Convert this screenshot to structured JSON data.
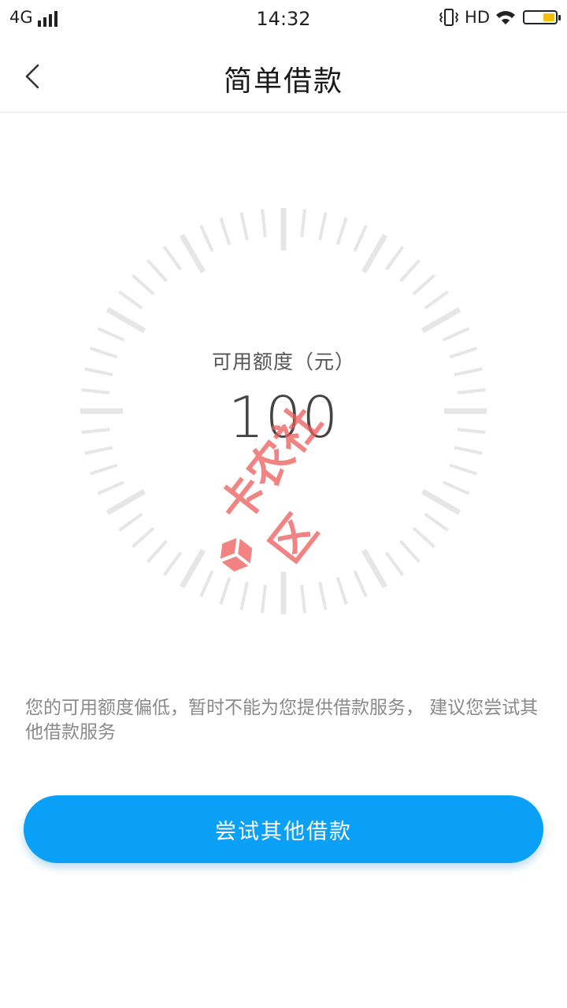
{
  "status_bar": {
    "network": "4G",
    "time": "14:32",
    "hd": "HD",
    "battery_level": 0.45,
    "battery_color": "#f6bf00"
  },
  "header": {
    "title": "简单借款",
    "back_icon": "chevron-left-icon"
  },
  "gauge": {
    "label": "可用额度（元）",
    "value": "100",
    "tick_color": "#e6e6e6"
  },
  "watermark": {
    "text": "卡农社区",
    "color": "#ec5a5a"
  },
  "message": "您的可用额度偏低，暂时不能为您提供借款服务， 建议您尝试其他借款服务",
  "button": {
    "label": "尝试其他借款",
    "color": "#0aa0f8"
  }
}
